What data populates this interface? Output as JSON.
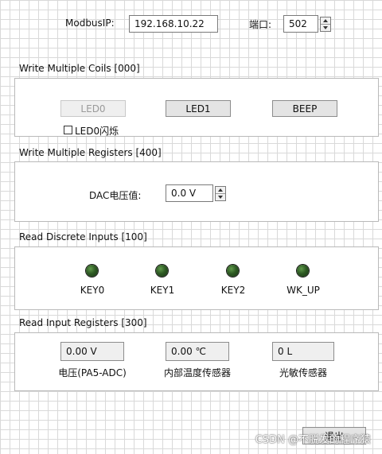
{
  "header": {
    "ip_label": "ModbusIP:",
    "ip_value": "192.168.10.22",
    "port_label": "端口:",
    "port_value": "502"
  },
  "coils": {
    "title": "Write Multiple Coils [000]",
    "buttons": [
      {
        "label": "LED0",
        "enabled": false
      },
      {
        "label": "LED1",
        "enabled": true
      },
      {
        "label": "BEEP",
        "enabled": true
      }
    ],
    "checkbox_label": "LED0闪烁",
    "checkbox_checked": false
  },
  "registers": {
    "title": "Write Multiple Registers [400]",
    "dac_label": "DAC电压值:",
    "dac_value": "0.0 V"
  },
  "discrete": {
    "title": "Read Discrete Inputs [100]",
    "leds": [
      {
        "label": "KEY0",
        "on": false
      },
      {
        "label": "KEY1",
        "on": false
      },
      {
        "label": "KEY2",
        "on": false
      },
      {
        "label": "WK_UP",
        "on": false
      }
    ]
  },
  "input_regs": {
    "title": "Read Input Registers [300]",
    "readouts": [
      {
        "value": "0.00 V",
        "label": "电压(PA5-ADC)"
      },
      {
        "value": "0.00 ℃",
        "label": "内部温度传感器"
      },
      {
        "value": "0 L",
        "label": "光敏传感器"
      }
    ]
  },
  "footer": {
    "exit_label": "退出",
    "watermark": "CSDN @不脱发的程序猿"
  },
  "colors": {
    "led_off": "#2e5a24",
    "grid": "#d9d9d9"
  }
}
